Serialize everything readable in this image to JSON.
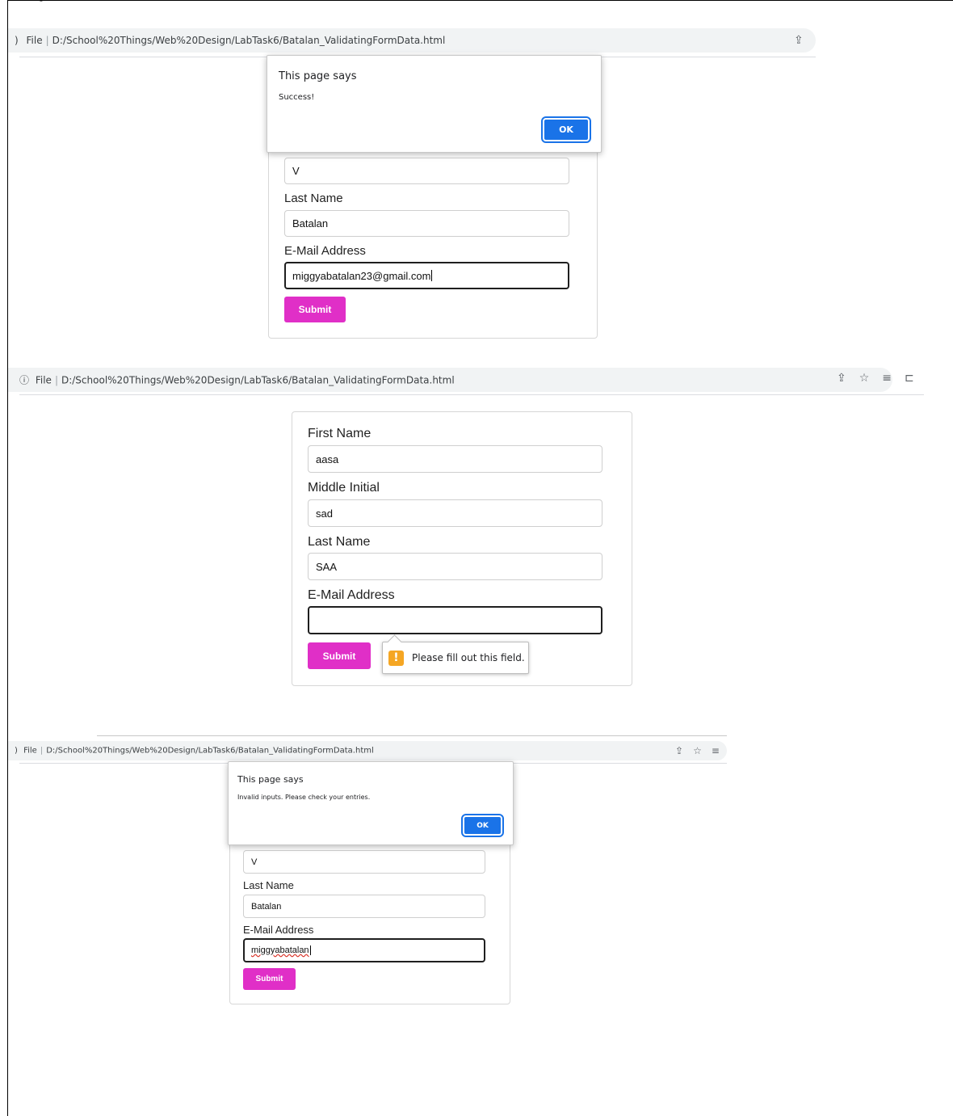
{
  "browser": {
    "file_label": "File",
    "url": "D:/School%20Things/Web%20Design/LabTask6/Batalan_ValidatingFormData.html"
  },
  "screens": [
    {
      "dialog": {
        "title": "This page says",
        "message": "Success!",
        "ok_label": "OK"
      },
      "form": {
        "middle_initial_value": "V",
        "last_name_label": "Last Name",
        "last_name_value": "Batalan",
        "email_label": "E-Mail Address",
        "email_value": "miggyabatalan23@gmail.com",
        "submit_label": "Submit"
      }
    },
    {
      "form": {
        "first_name_label": "First Name",
        "first_name_value": "aasa",
        "middle_initial_label": "Middle Initial",
        "middle_initial_value": "sad",
        "last_name_label": "Last Name",
        "last_name_value": "SAA",
        "email_label": "E-Mail Address",
        "email_value": "",
        "submit_label": "Submit"
      },
      "tooltip": {
        "message": "Please fill out this field."
      }
    },
    {
      "dialog": {
        "title": "This page says",
        "message": "Invalid inputs. Please check your entries.",
        "ok_label": "OK"
      },
      "form": {
        "middle_initial_value": "V",
        "last_name_label": "Last Name",
        "last_name_value": "Batalan",
        "email_label": "E-Mail Address",
        "email_value": "miggyabatalan",
        "submit_label": "Submit"
      }
    }
  ],
  "icons": [
    "info-icon",
    "share-icon",
    "star-icon",
    "reading-list-icon",
    "side-panel-icon",
    "menu-icon",
    "warning-icon"
  ],
  "colors": {
    "submit": "#e02fc7",
    "ok": "#1a73e8",
    "warning": "#f5a623"
  }
}
